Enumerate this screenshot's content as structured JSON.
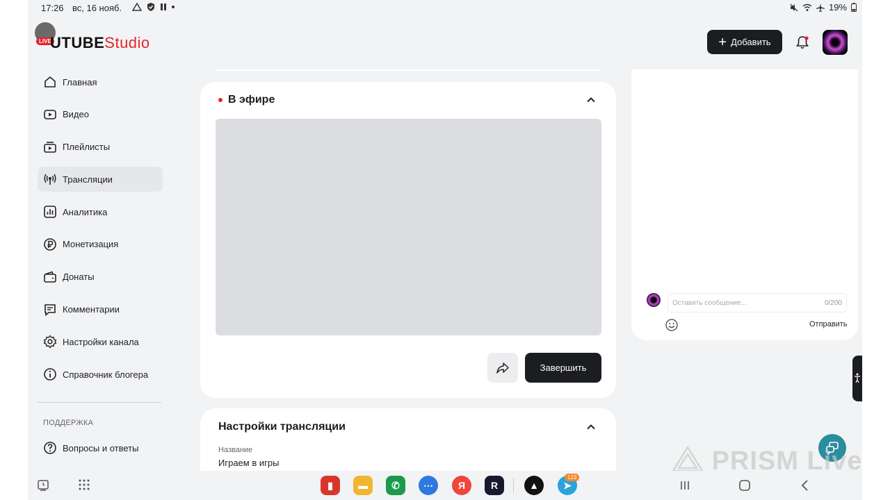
{
  "status_bar": {
    "time": "17:26",
    "date": "вс, 16 нояб.",
    "battery": "19%"
  },
  "header": {
    "brand_main": "UTUBE",
    "brand_studio": "Studio",
    "live_badge": "LIVE",
    "add_label": "Добавить"
  },
  "sidebar": {
    "items": [
      {
        "label": "Главная",
        "icon": "home-icon"
      },
      {
        "label": "Видео",
        "icon": "video-icon"
      },
      {
        "label": "Плейлисты",
        "icon": "playlist-icon"
      },
      {
        "label": "Трансляции",
        "icon": "broadcast-icon",
        "active": true
      },
      {
        "label": "Аналитика",
        "icon": "analytics-icon"
      },
      {
        "label": "Монетизация",
        "icon": "ruble-icon"
      },
      {
        "label": "Донаты",
        "icon": "wallet-icon"
      },
      {
        "label": "Комментарии",
        "icon": "comment-icon"
      },
      {
        "label": "Настройки канала",
        "icon": "gear-icon"
      },
      {
        "label": "Справочник блогера",
        "icon": "info-icon"
      }
    ],
    "support_title": "ПОДДЕРЖКА",
    "faq_label": "Вопросы и ответы"
  },
  "live_card": {
    "title": "В эфире",
    "finish_label": "Завершить"
  },
  "settings_card": {
    "title": "Настройки трансляции",
    "name_label": "Название",
    "name_value": "Играем в игры"
  },
  "chat": {
    "placeholder": "Оставить сообщение...",
    "counter": "0/200",
    "send_label": "Отправить"
  },
  "watermark": "PRISM Live",
  "taskbar": {
    "telegram_badge": "123"
  },
  "colors": {
    "accent": "#e5232b",
    "dark": "#1c1d21",
    "background": "#f2f3f5"
  }
}
